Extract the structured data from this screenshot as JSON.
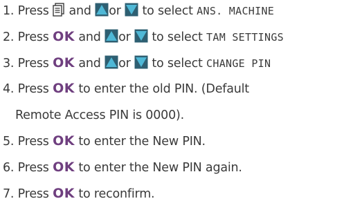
{
  "steps": [
    {
      "number": "1.",
      "press": "Press",
      "and": "and",
      "or": "or",
      "to_select": "to select",
      "display_text": "ANS. MACHINE"
    },
    {
      "number": "2.",
      "press": "Press",
      "ok": "OK",
      "and": "and",
      "or": "or",
      "to_select": "to select",
      "display_text": "TAM SETTINGS"
    },
    {
      "number": "3.",
      "press": "Press",
      "ok": "OK",
      "and": "and",
      "or": "or",
      "to_select": "to select",
      "display_text": "CHANGE PIN"
    },
    {
      "number": "4.",
      "press": "Press",
      "ok": "OK",
      "text": "to enter the old PIN. (Default",
      "text_line2": "Remote Access PIN is 0000)."
    },
    {
      "number": "5.",
      "press": "Press",
      "ok": "OK",
      "text": "to enter the New PIN."
    },
    {
      "number": "6.",
      "press": "Press",
      "ok": "OK",
      "text": "to enter the New PIN again."
    },
    {
      "number": "7.",
      "press": "Press",
      "ok": "OK",
      "text": "to reconfirm."
    }
  ],
  "colors": {
    "text": "#3a3a3a",
    "ok_key": "#6f3f7f",
    "arrow_fill": "#4fb8d6",
    "arrow_border": "#2e5f72"
  },
  "icons": {
    "menu_key": "menu-key-icon",
    "up_key": "up-arrow-icon",
    "down_key": "down-arrow-icon"
  }
}
